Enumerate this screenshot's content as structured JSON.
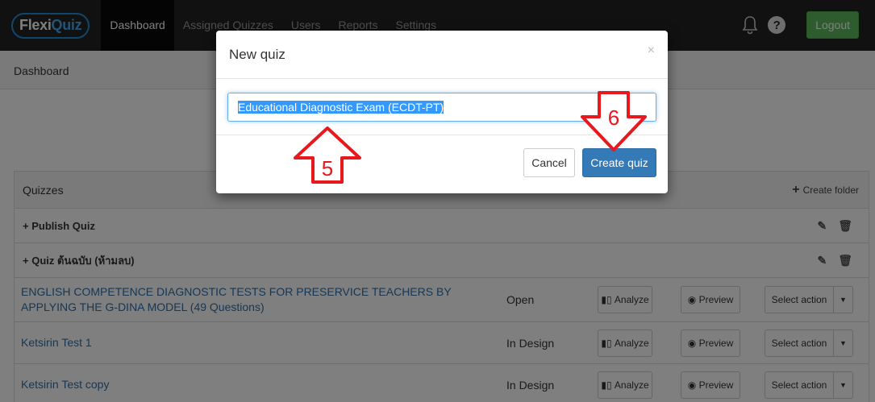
{
  "brand": {
    "part1": "Flexi",
    "part2": "Quiz"
  },
  "nav": {
    "items": [
      "Dashboard",
      "Assigned Quizzes",
      "Users",
      "Reports",
      "Settings"
    ]
  },
  "header": {
    "logout": "Logout",
    "help": "?"
  },
  "breadcrumb": "Dashboard",
  "panel": {
    "title": "Quizzes",
    "create_folder": "Create folder"
  },
  "folders": [
    {
      "label": "Publish Quiz"
    },
    {
      "label": "Quiz ต้นฉบับ (ห้ามลบ)"
    }
  ],
  "quizzes": [
    {
      "name": "ENGLISH COMPETENCE DIAGNOSTIC TESTS FOR PRESERVICE TEACHERS BY APPLYING THE G-DINA MODEL (49 Questions)",
      "status": "Open"
    },
    {
      "name": "Ketsirin Test 1",
      "status": "In Design"
    },
    {
      "name": "Ketsirin Test copy",
      "status": "In Design"
    }
  ],
  "row_actions": {
    "analyze": "Analyze",
    "preview": "Preview",
    "select": "Select action"
  },
  "modal": {
    "title": "New quiz",
    "close": "×",
    "input_value": "Educational Diagnostic Exam (ECDT-PT)",
    "cancel": "Cancel",
    "create": "Create quiz"
  },
  "annotations": {
    "step5": "5",
    "step6": "6",
    "color": "#e8191d"
  }
}
